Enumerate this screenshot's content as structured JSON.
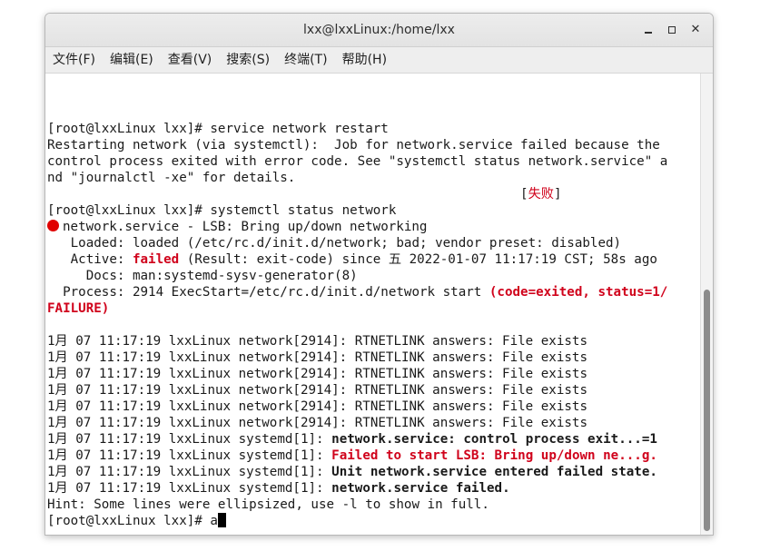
{
  "window": {
    "title": "lxx@lxxLinux:/home/lxx",
    "min_glyph": "—",
    "max_glyph": "□",
    "close_glyph": "✕"
  },
  "menu": [
    "文件(F)",
    "编辑(E)",
    "查看(V)",
    "搜索(S)",
    "终端(T)",
    "帮助(H)"
  ],
  "terminal": {
    "lines": [
      {
        "segments": [
          {
            "text": "[root@lxxLinux lxx]# service network restart"
          }
        ]
      },
      {
        "segments": [
          {
            "text": "Restarting network (via systemctl):  Job for network.service failed because the"
          }
        ]
      },
      {
        "segments": [
          {
            "text": "control process exited with error code. See \"systemctl status network.service\" a"
          }
        ]
      },
      {
        "segments": [
          {
            "text": "nd \"journalctl -xe\" for details."
          }
        ]
      },
      {
        "segments": [
          {
            "text": "                                                             ["
          },
          {
            "text": "失败",
            "style": "red"
          },
          {
            "text": "]"
          }
        ]
      },
      {
        "segments": [
          {
            "text": "[root@lxxLinux lxx]# systemctl status network"
          }
        ]
      },
      {
        "dot": true,
        "segments": [
          {
            "text": "network.service - LSB: Bring up/down networking"
          }
        ]
      },
      {
        "segments": [
          {
            "text": "   Loaded: loaded (/etc/rc.d/init.d/network; bad; vendor preset: disabled)"
          }
        ]
      },
      {
        "segments": [
          {
            "text": "   Active: "
          },
          {
            "text": "failed",
            "style": "red bold"
          },
          {
            "text": " (Result: exit-code) since 五 2022-01-07 11:17:19 CST; 58s ago"
          }
        ]
      },
      {
        "segments": [
          {
            "text": "     Docs: man:systemd-sysv-generator(8)"
          }
        ]
      },
      {
        "segments": [
          {
            "text": "  Process: 2914 ExecStart=/etc/rc.d/init.d/network start "
          },
          {
            "text": "(code=exited, status=1/",
            "style": "red bold"
          }
        ]
      },
      {
        "segments": [
          {
            "text": "FAILURE)",
            "style": "red bold"
          }
        ]
      },
      {
        "segments": [
          {
            "text": ""
          }
        ]
      },
      {
        "segments": [
          {
            "text": "1月 07 11:17:19 lxxLinux network[2914]: RTNETLINK answers: File exists"
          }
        ]
      },
      {
        "segments": [
          {
            "text": "1月 07 11:17:19 lxxLinux network[2914]: RTNETLINK answers: File exists"
          }
        ]
      },
      {
        "segments": [
          {
            "text": "1月 07 11:17:19 lxxLinux network[2914]: RTNETLINK answers: File exists"
          }
        ]
      },
      {
        "segments": [
          {
            "text": "1月 07 11:17:19 lxxLinux network[2914]: RTNETLINK answers: File exists"
          }
        ]
      },
      {
        "segments": [
          {
            "text": "1月 07 11:17:19 lxxLinux network[2914]: RTNETLINK answers: File exists"
          }
        ]
      },
      {
        "segments": [
          {
            "text": "1月 07 11:17:19 lxxLinux network[2914]: RTNETLINK answers: File exists"
          }
        ]
      },
      {
        "segments": [
          {
            "text": "1月 07 11:17:19 lxxLinux systemd[1]: "
          },
          {
            "text": "network.service: control process exit...=1",
            "style": "bold"
          }
        ]
      },
      {
        "segments": [
          {
            "text": "1月 07 11:17:19 lxxLinux systemd[1]: "
          },
          {
            "text": "Failed to start LSB: Bring up/down ne...g.",
            "style": "red bold"
          }
        ]
      },
      {
        "segments": [
          {
            "text": "1月 07 11:17:19 lxxLinux systemd[1]: "
          },
          {
            "text": "Unit network.service entered failed state.",
            "style": "bold"
          }
        ]
      },
      {
        "segments": [
          {
            "text": "1月 07 11:17:19 lxxLinux systemd[1]: "
          },
          {
            "text": "network.service failed.",
            "style": "bold"
          }
        ]
      },
      {
        "segments": [
          {
            "text": "Hint: Some lines were ellipsized, use -l to show in full."
          }
        ]
      },
      {
        "cursor": true,
        "segments": [
          {
            "text": "[root@lxxLinux lxx]# a"
          }
        ]
      }
    ]
  }
}
